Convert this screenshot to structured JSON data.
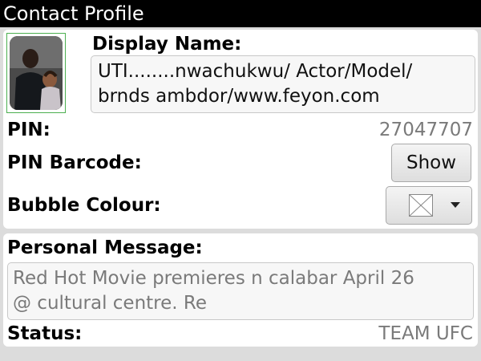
{
  "header": {
    "title": "Contact Profile"
  },
  "profile": {
    "avatar_icon": "contact-photo",
    "display_name_label": "Display Name:",
    "display_name_line1": "UTI........nwachukwu/ Actor/Model/",
    "display_name_line2": "brnds ambdor/www.feyon.com",
    "pin_label": "PIN:",
    "pin_value": "27047707",
    "pin_barcode_label": "PIN Barcode:",
    "show_button_label": "Show",
    "bubble_colour_label": "Bubble Colour:",
    "bubble_colour_icon": "empty-swatch-icon"
  },
  "message": {
    "personal_message_label": "Personal Message:",
    "personal_message_line1": "Red Hot Movie premieres n calabar April 26",
    "personal_message_line2": "@ cultural centre. Re",
    "status_label": "Status:",
    "status_value": "TEAM UFC"
  },
  "colors": {
    "title_bar": "#000000",
    "avatar_border": "#4caf50",
    "muted_text": "#7a7a7a"
  }
}
